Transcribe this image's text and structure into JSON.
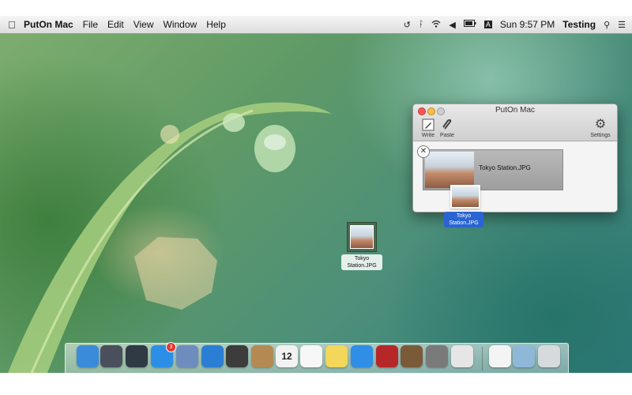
{
  "menubar": {
    "apple_icon": "apple-icon",
    "app_name": "PutOn Mac",
    "menus": [
      "File",
      "Edit",
      "View",
      "Window",
      "Help"
    ],
    "status_icons": [
      "time-machine-icon",
      "bluetooth-icon",
      "wifi-icon",
      "volume-icon",
      "battery-icon",
      "input-source-icon"
    ],
    "input_source": "A",
    "clock": "Sun 9:57 PM",
    "user": "Testing",
    "spotlight_icon": "search-icon",
    "notification_icon": "list-icon"
  },
  "window": {
    "title": "PutOn Mac",
    "toolbar": {
      "write_label": "Write",
      "paste_label": "Paste",
      "settings_label": "Settings"
    },
    "file": {
      "name": "Tokyo Station.JPG"
    }
  },
  "drag_label": "Tokyo Station.JPG",
  "desktop_file": {
    "label": "Tokyo Station.JPG"
  },
  "dock": {
    "items": [
      {
        "name": "finder-icon",
        "color": "#3a8bd9"
      },
      {
        "name": "launchpad-icon",
        "color": "#4a4f5c"
      },
      {
        "name": "mission-control-icon",
        "color": "#2f3a44"
      },
      {
        "name": "app-store-icon",
        "color": "#2b8fe8",
        "badge": "3"
      },
      {
        "name": "preview-icon",
        "color": "#6f8cbf"
      },
      {
        "name": "safari-icon",
        "color": "#2a7fd4"
      },
      {
        "name": "facetime-icon",
        "color": "#3c3c3c"
      },
      {
        "name": "contacts-icon",
        "color": "#b58a52"
      },
      {
        "name": "calendar-icon",
        "color": "#f2f2f2",
        "text": "12"
      },
      {
        "name": "reminders-icon",
        "color": "#f7f7f7"
      },
      {
        "name": "notes-icon",
        "color": "#f2d75a"
      },
      {
        "name": "itunes-icon",
        "color": "#2f8ee6"
      },
      {
        "name": "photo-booth-icon",
        "color": "#b6272a"
      },
      {
        "name": "iphoto-icon",
        "color": "#7b5a3a"
      },
      {
        "name": "system-preferences-icon",
        "color": "#7a7a7a"
      },
      {
        "name": "puton-icon",
        "color": "#e6e6e6"
      },
      {
        "name": "documents-stack-icon",
        "color": "#f4f4f4"
      },
      {
        "name": "downloads-folder-icon",
        "color": "#8fb8d8"
      },
      {
        "name": "trash-icon",
        "color": "#d6dadc"
      }
    ]
  }
}
